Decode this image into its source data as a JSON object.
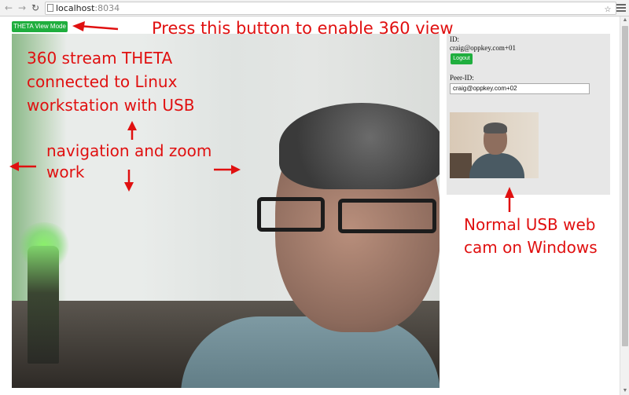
{
  "browser": {
    "url_host": "localhost",
    "url_port": ":8034",
    "icons": [
      "back-icon",
      "forward-icon",
      "reload-icon",
      "page-icon",
      "bookmark-star-icon",
      "extension-icon",
      "menu-icon"
    ]
  },
  "theta_button_label": "THETA View Mode",
  "panel": {
    "id_label": "ID:",
    "id_value": "craig@oppkey.com+01",
    "logout_label": "Logout",
    "peer_label": "Peer-ID:",
    "peer_value": "craig@oppkey.com+02"
  },
  "annotations": {
    "press_button": "Press this button to enable 360 view",
    "stream_line1": "360 stream THETA",
    "stream_line2": "connected to Linux",
    "stream_line3": "workstation with USB",
    "nav_line1": "navigation and zoom",
    "nav_line2": "work",
    "webcam_line1": "Normal USB web",
    "webcam_line2": "cam on Windows"
  },
  "colors": {
    "button_green": "#1fae3e",
    "annotation_red": "#e01010",
    "panel_gray": "#e7e7e7"
  }
}
